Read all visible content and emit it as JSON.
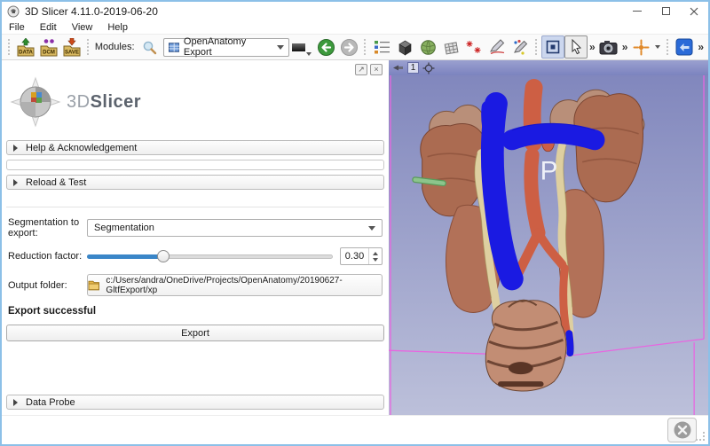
{
  "window": {
    "title": "3D Slicer 4.11.0-2019-06-20"
  },
  "menu": {
    "items": [
      "File",
      "Edit",
      "View",
      "Help"
    ]
  },
  "toolbar": {
    "load_data_label": "DATA",
    "dicom_label": "DCM",
    "save_label": "SAVE",
    "modules_label": "Modules:",
    "module_selected": "OpenAnatomy Export",
    "overflow_chevron": "»"
  },
  "panel": {
    "logo_3d": "3D",
    "logo_slicer": "Slicer",
    "help_section": "Help & Acknowledgement",
    "reload_section": "Reload & Test",
    "data_probe_section": "Data Probe",
    "segmentation_label": "Segmentation to export:",
    "segmentation_value": "Segmentation",
    "reduction_label": "Reduction factor:",
    "reduction_value": "0.30",
    "output_label": "Output folder:",
    "output_path": "c:/Users/andra/OneDrive/Projects/OpenAnatomy/20190627-GltfExport/xp",
    "status_message": "Export successful",
    "export_button": "Export"
  },
  "view3d": {
    "view_number": "1",
    "orientation_label": "P",
    "colors": {
      "background_top": "#8187bd",
      "background_bottom": "#bcc0da",
      "roi_box": "#e866e0",
      "vein_blue": "#1a1ae2",
      "artery_red": "#cd5f44",
      "ureter_cream": "#decfa0",
      "kidney_brown": "#ab6b51",
      "muscle_salmon": "#b27158",
      "bone_tan": "#c28d74",
      "marker_green": "#7cb77c"
    }
  }
}
